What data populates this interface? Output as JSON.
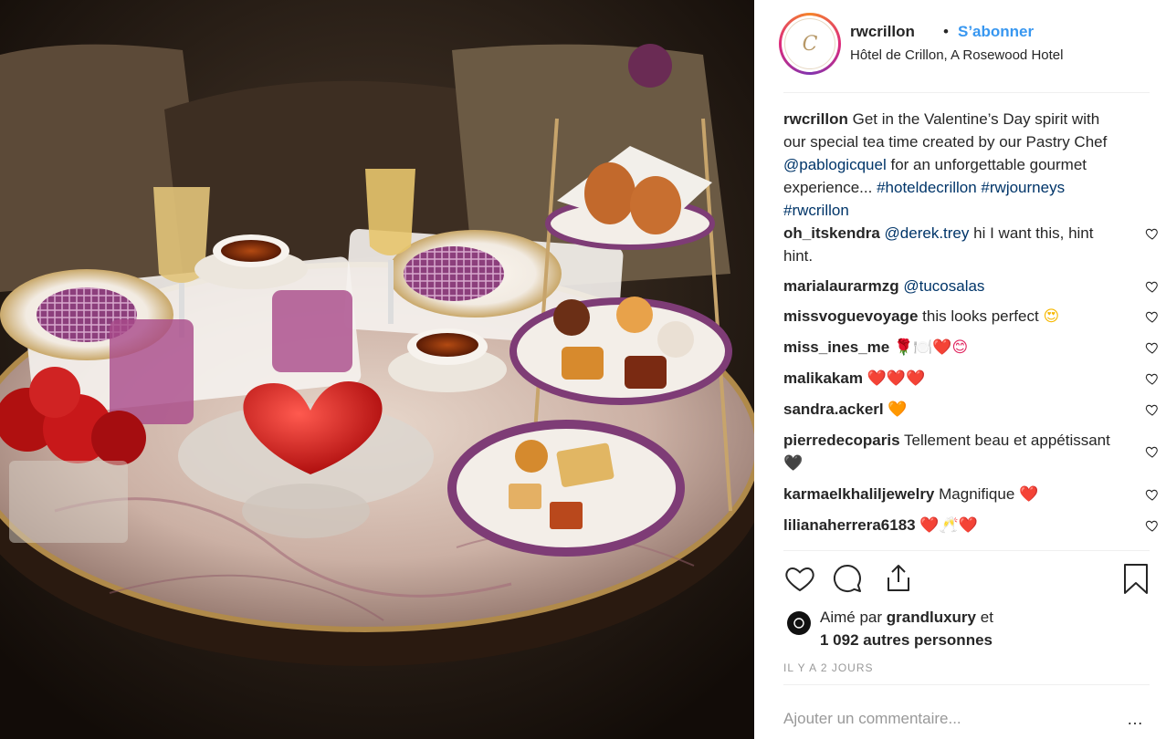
{
  "header": {
    "avatar_glyph": "C",
    "username": "rwcrillon",
    "dot": "•",
    "follow_label": "S’abonner",
    "location": "Hôtel de Crillon, A Rosewood Hotel"
  },
  "caption": {
    "username": "rwcrillon",
    "text1": "Get in the Valentine’s Day spirit with our special tea time created by our Pastry Chef",
    "mention": "@pablogicquel",
    "text2": "for an unforgettable gourmet experience...",
    "hashtags": "#hoteldecrillon #rwjourneys #rwcrillon"
  },
  "comments": [
    {
      "username": "oh_itskendra",
      "mention": "@derek.trey",
      "text": "hi I want this, hint hint.",
      "emoji": ""
    },
    {
      "username": "marialaurarmzg",
      "mention": "@tucosalas",
      "text": "",
      "emoji": ""
    },
    {
      "username": "missvoguevoyage",
      "mention": "",
      "text": "this looks perfect",
      "emoji": "😍"
    },
    {
      "username": "miss_ines_me",
      "mention": "",
      "text": "",
      "emoji": "🌹🍽️❤️😊"
    },
    {
      "username": "malikakam",
      "mention": "",
      "text": "",
      "emoji": "❤️❤️❤️"
    },
    {
      "username": "sandra.ackerl",
      "mention": "",
      "text": "",
      "emoji": "🧡"
    },
    {
      "username": "pierredecoparis",
      "mention": "",
      "text": "Tellement beau et appétissant",
      "emoji": "🖤"
    },
    {
      "username": "karmaelkhaliljewelry",
      "mention": "",
      "text": "Magnifique",
      "emoji": "❤️"
    },
    {
      "username": "lilianaherrera6183",
      "mention": "",
      "text": "",
      "emoji": "❤️🥂❤️"
    }
  ],
  "likes": {
    "prefix": "Aimé par",
    "user": "grandluxury",
    "conj": "et",
    "others": "1 092 autres personnes"
  },
  "timestamp": "IL Y A 2 JOURS",
  "add_comment_placeholder": "Ajouter un commentaire...",
  "more": "…",
  "icons": {
    "like": "heart-icon",
    "comment": "comment-icon",
    "share": "share-icon",
    "save": "bookmark-icon",
    "comment_like": "small-heart-icon"
  },
  "colors": {
    "follow": "#3897f0",
    "mention": "#003569",
    "muted": "#999999",
    "text": "#262626"
  }
}
